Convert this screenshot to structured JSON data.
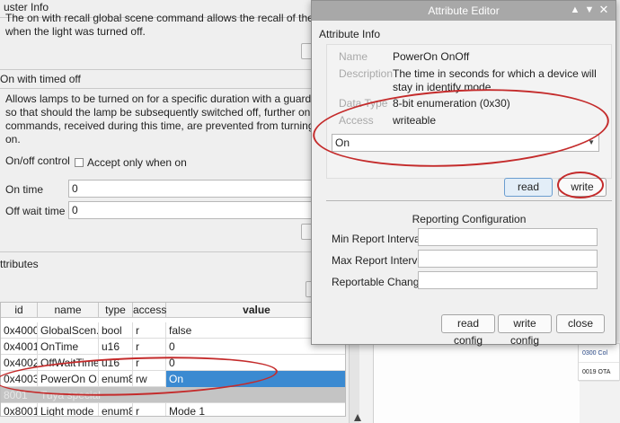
{
  "left": {
    "section1": {
      "head": "uster Info",
      "line1": "The on with recall global scene command allows the recall of the light se",
      "line2": "when the light was turned off."
    },
    "section2": {
      "head": "On with timed off",
      "line1": "Allows lamps to be turned on for a specific duration with a guarded off d",
      "line2": "so that should the lamp be subsequently switched off, further on with tin",
      "line3": "commands, received during this time, are prevented from turning the lan",
      "line4": "on.",
      "onoff_label": "On/off control",
      "checkbox_label": "Accept only when on",
      "ontime_label": "On time",
      "ontime_value": "0",
      "offwait_label": "Off wait time",
      "offwait_value": "0"
    },
    "attributes_head": "ttributes",
    "table": {
      "headers": [
        "id",
        "name",
        "type",
        "access",
        "value"
      ],
      "rows": [
        {
          "id": "0x4000",
          "name": "GlobalScen...",
          "type": "bool",
          "access": "r",
          "value": "false"
        },
        {
          "id": "0x4001",
          "name": "OnTime",
          "type": "u16",
          "access": "r",
          "value": "0"
        },
        {
          "id": "0x4002",
          "name": "OffWaitTime",
          "type": "u16",
          "access": "r",
          "value": "0"
        },
        {
          "id": "0x4003",
          "name": "PowerOn O...",
          "type": "enum8",
          "access": "rw",
          "value": "On"
        },
        {
          "id": "8001",
          "name": "Tuya special",
          "type": "",
          "access": "",
          "value": ""
        },
        {
          "id": "0x8001",
          "name": "Light mode",
          "type": "enum8",
          "access": "r",
          "value": "Mode 1"
        }
      ]
    }
  },
  "right_panel": {
    "rows": [
      "0300  Col",
      "0019  OTA"
    ]
  },
  "dialog": {
    "title": "Attribute Editor",
    "titlebar_icons": [
      "chevron-up-icon",
      "chevron-down-icon",
      "close-icon"
    ],
    "group_label": "Attribute Info",
    "name_key": "Name",
    "name_value": "PowerOn OnOff",
    "desc_key": "Description",
    "desc_value": "The time in seconds for which a device will stay in identify mode.",
    "datatype_key": "Data Type",
    "datatype_value": "8-bit enumeration (0x30)",
    "access_key": "Access",
    "access_value": "writeable",
    "select_value": "On",
    "read_label": "read",
    "write_label": "write",
    "reporting_title": "Reporting Configuration",
    "min_label": "Min Report Interval",
    "max_label": "Max Report Interval",
    "change_label": "Reportable Change",
    "read_config_label": "read config",
    "write_config_label": "write config",
    "close_label": "close"
  },
  "colors": {
    "annotation": "#c42b2b",
    "selection": "#3b8ad1",
    "titlebar": "#a8a8a8"
  }
}
